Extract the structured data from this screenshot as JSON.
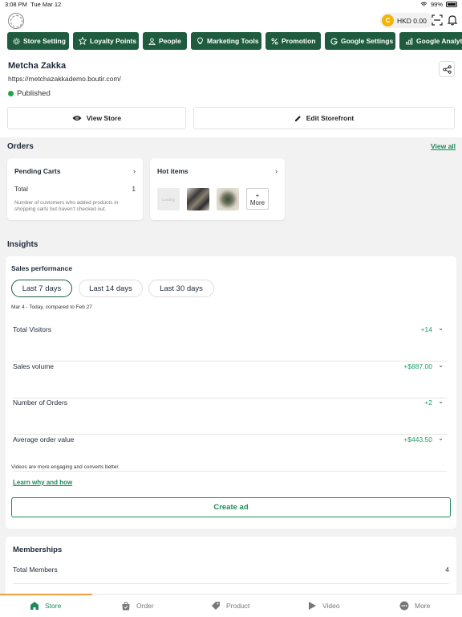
{
  "status_bar": {
    "time": "3:08 PM",
    "date": "Tue Mar 12",
    "battery": "99%"
  },
  "header": {
    "balance": "HKD 0.00",
    "coin_letter": "C"
  },
  "tabs": [
    {
      "label": "Store Setting",
      "icon": "gear-icon"
    },
    {
      "label": "Loyalty Points",
      "icon": "star-icon"
    },
    {
      "label": "People",
      "icon": "person-icon"
    },
    {
      "label": "Marketing Tools",
      "icon": "lightbulb-icon"
    },
    {
      "label": "Promotion",
      "icon": "percent-icon"
    },
    {
      "label": "Google Settings",
      "icon": "google-icon"
    },
    {
      "label": "Google Analytics",
      "icon": "bar-chart-icon"
    }
  ],
  "store": {
    "name": "Metcha Zakka",
    "url": "https://metchazakkademo.boutir.com/",
    "status": "Published",
    "view_store": "View Store",
    "edit_storefront": "Edit Storefront"
  },
  "orders": {
    "title": "Orders",
    "view_all": "View all",
    "pending_carts": {
      "title": "Pending Carts",
      "total_label": "Total",
      "total_value": "1",
      "note": "Number of customers who added products in shopping carts but haven't checked out."
    },
    "hot_items": {
      "title": "Hot items",
      "more_plus": "+",
      "more_label": "More",
      "placeholder": "Loading"
    }
  },
  "insights": {
    "title": "Insights",
    "sales_performance": "Sales performance",
    "periods": [
      "Last 7 days",
      "Last 14 days",
      "Last 30 days"
    ],
    "active_period": "Last 7 days",
    "date_range": "Mar 4 - Today, compared to Feb 27",
    "metrics": [
      {
        "label": "Total Visitors",
        "value": "+14"
      },
      {
        "label": "Sales volume",
        "value": "+$887.00"
      },
      {
        "label": "Number of Orders",
        "value": "+2"
      },
      {
        "label": "Average order value",
        "value": "+$443.50"
      }
    ],
    "video_note": "Videos are more engaging and converts better.",
    "learn_link": "Learn why and how",
    "create_ad": "Create ad"
  },
  "memberships": {
    "title": "Memberships",
    "total_label": "Total Members",
    "total_value": "4"
  },
  "bottom_nav": [
    {
      "label": "Store",
      "icon": "store-icon",
      "active": true
    },
    {
      "label": "Order",
      "icon": "bag-icon",
      "active": false
    },
    {
      "label": "Product",
      "icon": "tag-icon",
      "active": false
    },
    {
      "label": "Video",
      "icon": "play-icon",
      "active": false
    },
    {
      "label": "More",
      "icon": "more-icon",
      "active": false
    }
  ],
  "colors": {
    "brand_green": "#1f5c3f",
    "accent_green": "#1e8a5a",
    "positive": "#23a06b",
    "published": "#22a647",
    "coin": "#f5b400",
    "nav_indicator": "#f0a040"
  }
}
